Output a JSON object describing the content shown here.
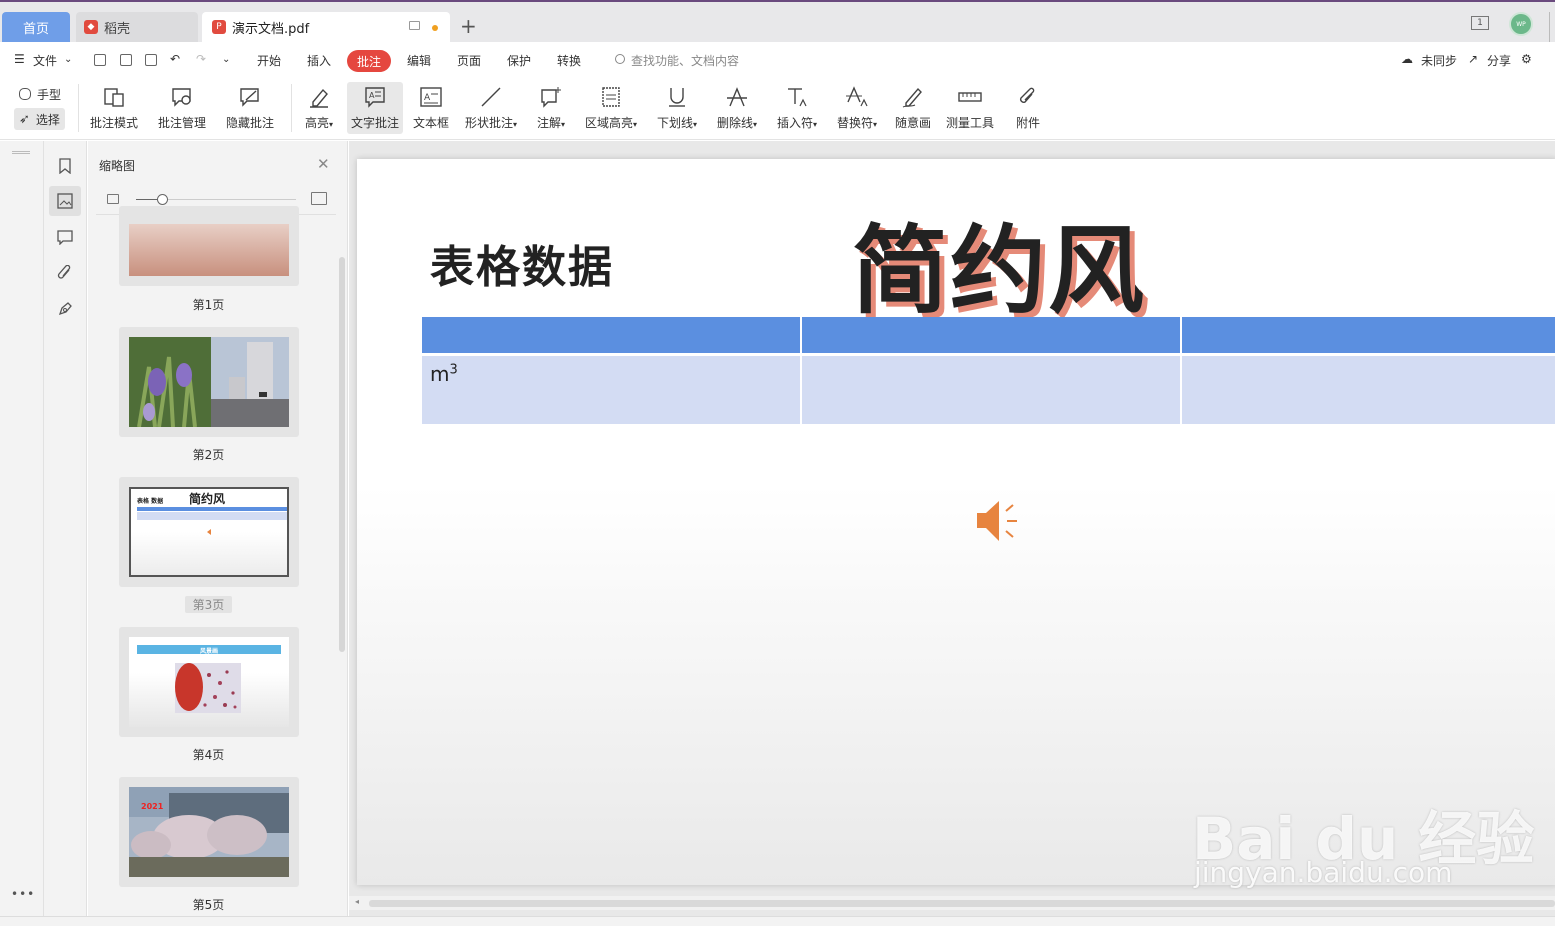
{
  "tabs": {
    "home": "首页",
    "daoke": "稻壳",
    "doc": "演示文档.pdf"
  },
  "menu": {
    "file": "文件",
    "items": [
      "开始",
      "插入",
      "批注",
      "编辑",
      "页面",
      "保护",
      "转换"
    ],
    "active": "批注",
    "search_placeholder": "查找功能、文档内容",
    "sync": "未同步",
    "share": "分享"
  },
  "ribbon": {
    "hand": "手型",
    "select": "选择",
    "tools": [
      "批注模式",
      "批注管理",
      "隐藏批注",
      "高亮",
      "文字批注",
      "文本框",
      "形状批注",
      "注解",
      "区域高亮",
      "下划线",
      "删除线",
      "插入符",
      "替换符",
      "随意画",
      "测量工具",
      "附件"
    ]
  },
  "panel": {
    "title": "缩略图",
    "pages": [
      "第1页",
      "第2页",
      "第3页",
      "第4页",
      "第5页"
    ],
    "selected_page": "第3页"
  },
  "slide": {
    "label": "表格数据",
    "title": "简约风",
    "cell": "m",
    "cell_sup": "3"
  },
  "thumbs": {
    "p3_label": "表格 数据",
    "p3_title": "简约风",
    "p4_title": "风景画",
    "p5_year": "2021"
  },
  "avatar": "WP",
  "watermark": {
    "main": "Bai du 经验",
    "sub": "jingyan.baidu.com"
  },
  "colors": {
    "accent": "#e5473f",
    "table_header": "#5b8fe0",
    "table_body": "#d3dcf3",
    "title_shadow": "#e58a78",
    "speaker": "#e7843f"
  }
}
